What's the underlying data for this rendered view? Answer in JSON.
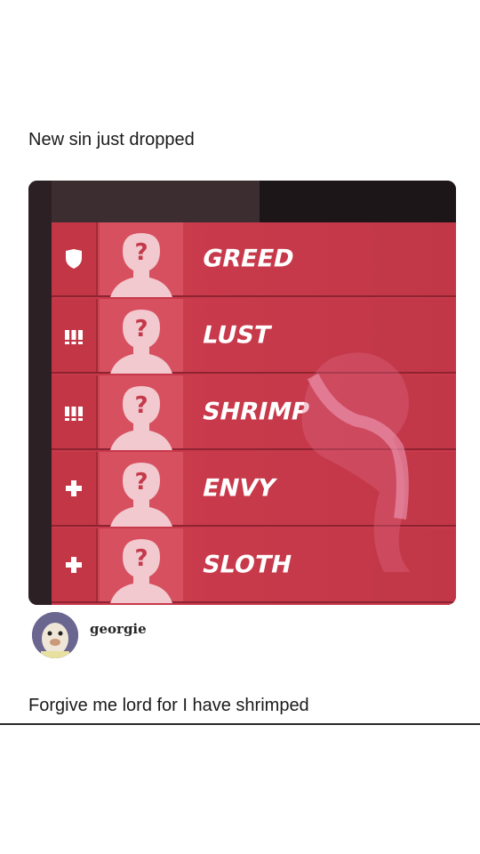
{
  "post": {
    "caption_top": "New sin just dropped",
    "caption_bottom": "Forgive me lord for I have shrimped"
  },
  "user": {
    "name": "georgie"
  },
  "scoreboard": {
    "rows": [
      {
        "role_icon": "shield-icon",
        "name": "GREED"
      },
      {
        "role_icon": "damage-icon",
        "name": "LUST"
      },
      {
        "role_icon": "damage-icon",
        "name": "SHRIMP"
      },
      {
        "role_icon": "support-icon",
        "name": "ENVY"
      },
      {
        "role_icon": "support-icon",
        "name": "SLOTH"
      }
    ]
  },
  "colors": {
    "row_red": "#c83a4b",
    "row_border": "#8e2331",
    "portrait_red": "#d7505f",
    "name_white": "#ffffff"
  }
}
